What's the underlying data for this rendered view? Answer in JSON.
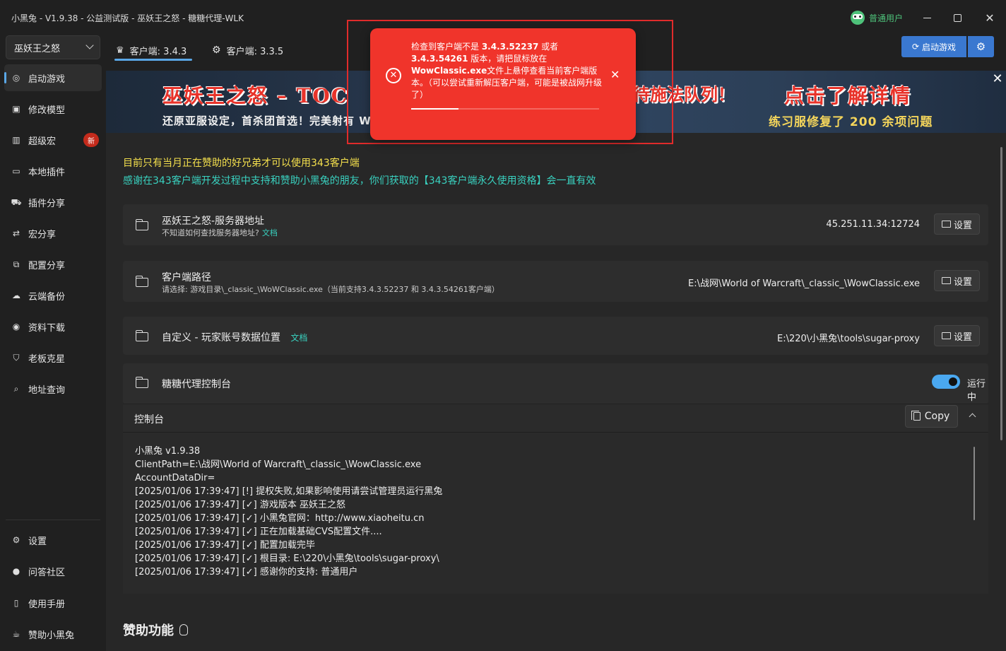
{
  "app": {
    "title": "小黑兔 - V1.9.38 - 公益测试版 - 巫妖王之怒 - 糖糖代理-WLK",
    "user_role": "普通用户"
  },
  "sidebar": {
    "game_select": "巫妖王之怒",
    "items": [
      {
        "label": "启动游戏",
        "icon": "launch-icon"
      },
      {
        "label": "修改模型",
        "icon": "model-icon"
      },
      {
        "label": "超级宏",
        "icon": "macro-icon",
        "badge": "新"
      },
      {
        "label": "本地插件",
        "icon": "folder-icon"
      },
      {
        "label": "插件分享",
        "icon": "cart-icon"
      },
      {
        "label": "宏分享",
        "icon": "share-icon"
      },
      {
        "label": "配置分享",
        "icon": "config-icon"
      },
      {
        "label": "云端备份",
        "icon": "cloud-icon"
      },
      {
        "label": "资料下载",
        "icon": "gamepad-icon"
      },
      {
        "label": "老板克星",
        "icon": "shield-icon"
      },
      {
        "label": "地址查询",
        "icon": "lookup-icon"
      }
    ],
    "bottom_items": [
      {
        "label": "设置",
        "icon": "gear-icon"
      },
      {
        "label": "问答社区",
        "icon": "chat-icon"
      },
      {
        "label": "使用手册",
        "icon": "book-icon"
      },
      {
        "label": "赞助小黑兔",
        "icon": "coffee-icon"
      }
    ]
  },
  "tabs": [
    {
      "label": "客户端: 3.4.3"
    },
    {
      "label": "客户端: 3.3.5"
    }
  ],
  "toolbar": {
    "launch_label": "启动游戏"
  },
  "banner": {
    "line1": "巫妖王之怒 – TOC",
    "line1b": "待施法队列！",
    "line1c": "点击了解详情",
    "line2": "还原亚服设定，首杀团首选！完美射有 WA + 新旧技能 完美适配 343 客户端 + 国服插件",
    "line2b": "练习服修复了 200 余项问题"
  },
  "notices": {
    "line1": "目前只有当月正在赞助的好兄弟才可以使用343客户端",
    "line2": "感谢在343客户端开发过程中支持和赞助小黑兔的朋友，你们获取的【343客户端永久使用资格】会一直有效"
  },
  "cards": {
    "server": {
      "title": "巫妖王之怒-服务器地址",
      "sub": "不知道如何查找服务器地址?",
      "doc": "文档",
      "value": "45.251.11.34:12724",
      "button": "设置"
    },
    "client": {
      "title": "客户端路径",
      "sub": "请选择: 游戏目录\\_classic_\\WoWClassic.exe（当前支持3.4.3.52237 和 3.4.3.54261客户端）",
      "value": "E:\\战网\\World of Warcraft\\_classic_\\WowClassic.exe",
      "button": "设置"
    },
    "account": {
      "title": "自定义 - 玩家账号数据位置",
      "doc": "文档",
      "value": "E:\\220\\小黑兔\\tools\\sugar-proxy",
      "button": "设置"
    },
    "proxy": {
      "title": "糖糖代理控制台",
      "status": "运行中",
      "running": true
    }
  },
  "console": {
    "label": "控制台",
    "copy": "Copy",
    "lines": [
      "小黑兔 v1.9.38",
      "ClientPath=E:\\战网\\World of Warcraft\\_classic_\\WowClassic.exe",
      "AccountDataDir=",
      "[2025/01/06 17:39:47] [!] 提权失败,如果影响使用请尝试管理员运行黑兔",
      "[2025/01/06 17:39:47] [✓] 游戏版本 巫妖王之怒",
      "[2025/01/06 17:39:47] [✓] 小黑兔官网：http://www.xiaoheitu.cn",
      "[2025/01/06 17:39:47] [✓] 正在加载基础CVS配置文件....",
      "[2025/01/06 17:39:47] [✓] 配置加载完毕",
      "[2025/01/06 17:39:47] [✓] 根目录: E:\\220\\小黑兔\\tools\\sugar-proxy\\",
      "[2025/01/06 17:39:47] [✓] 感谢你的支持: 普通用户"
    ]
  },
  "sponsor": {
    "title": "赞助功能"
  },
  "toast": {
    "line1_pre": "检查到客户端不是 ",
    "v1": "3.4.3.52237",
    "line1_mid": " 或者",
    "v2": "3.4.3.54261",
    "line2_post": " 版本，请把鼠标放在",
    "exe": "WowClassic.exe",
    "rest": "文件上悬停查看当前客户端版本。（可以尝试重新解压客户端，可能是被战网升级了）",
    "progress": 0.25
  },
  "colors": {
    "accent": "#3a78d0",
    "toast_bg": "#f0342b",
    "notice_yellow": "#f4e04d",
    "notice_cyan": "#39d2c0",
    "user_green": "#4ec27a"
  }
}
